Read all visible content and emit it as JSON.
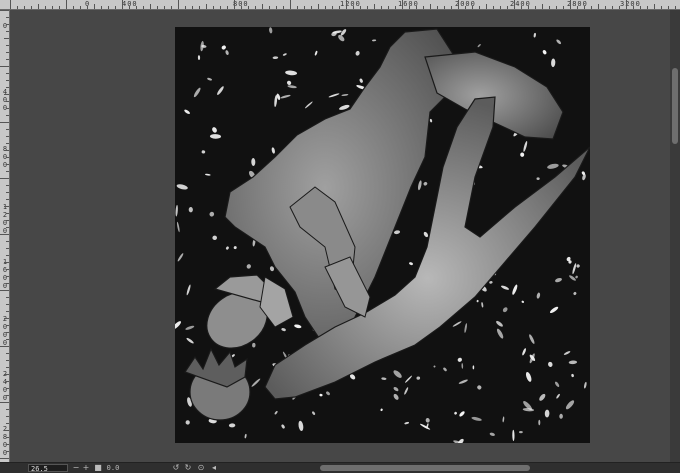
{
  "rulers": {
    "top_labels": [
      "0",
      "400",
      "800",
      "1200",
      "1600",
      "2000",
      "2400",
      "2800",
      "3200"
    ],
    "left_labels": [
      "0",
      "400",
      "800",
      "1200",
      "1600",
      "2000",
      "2400",
      "2800"
    ]
  },
  "status": {
    "zoom_value": "26.5",
    "minus_symbol": "−",
    "plus_symbol": "+",
    "angle_value": "0.0"
  },
  "colors": {
    "workspace": "#474747",
    "canvas_bg": "#111111"
  },
  "icons": [
    "zoom-out-icon",
    "zoom-in-icon",
    "fit-icon",
    "rotate-left-icon",
    "rotate-right-icon",
    "reset-rotation-icon",
    "flip-icon"
  ]
}
